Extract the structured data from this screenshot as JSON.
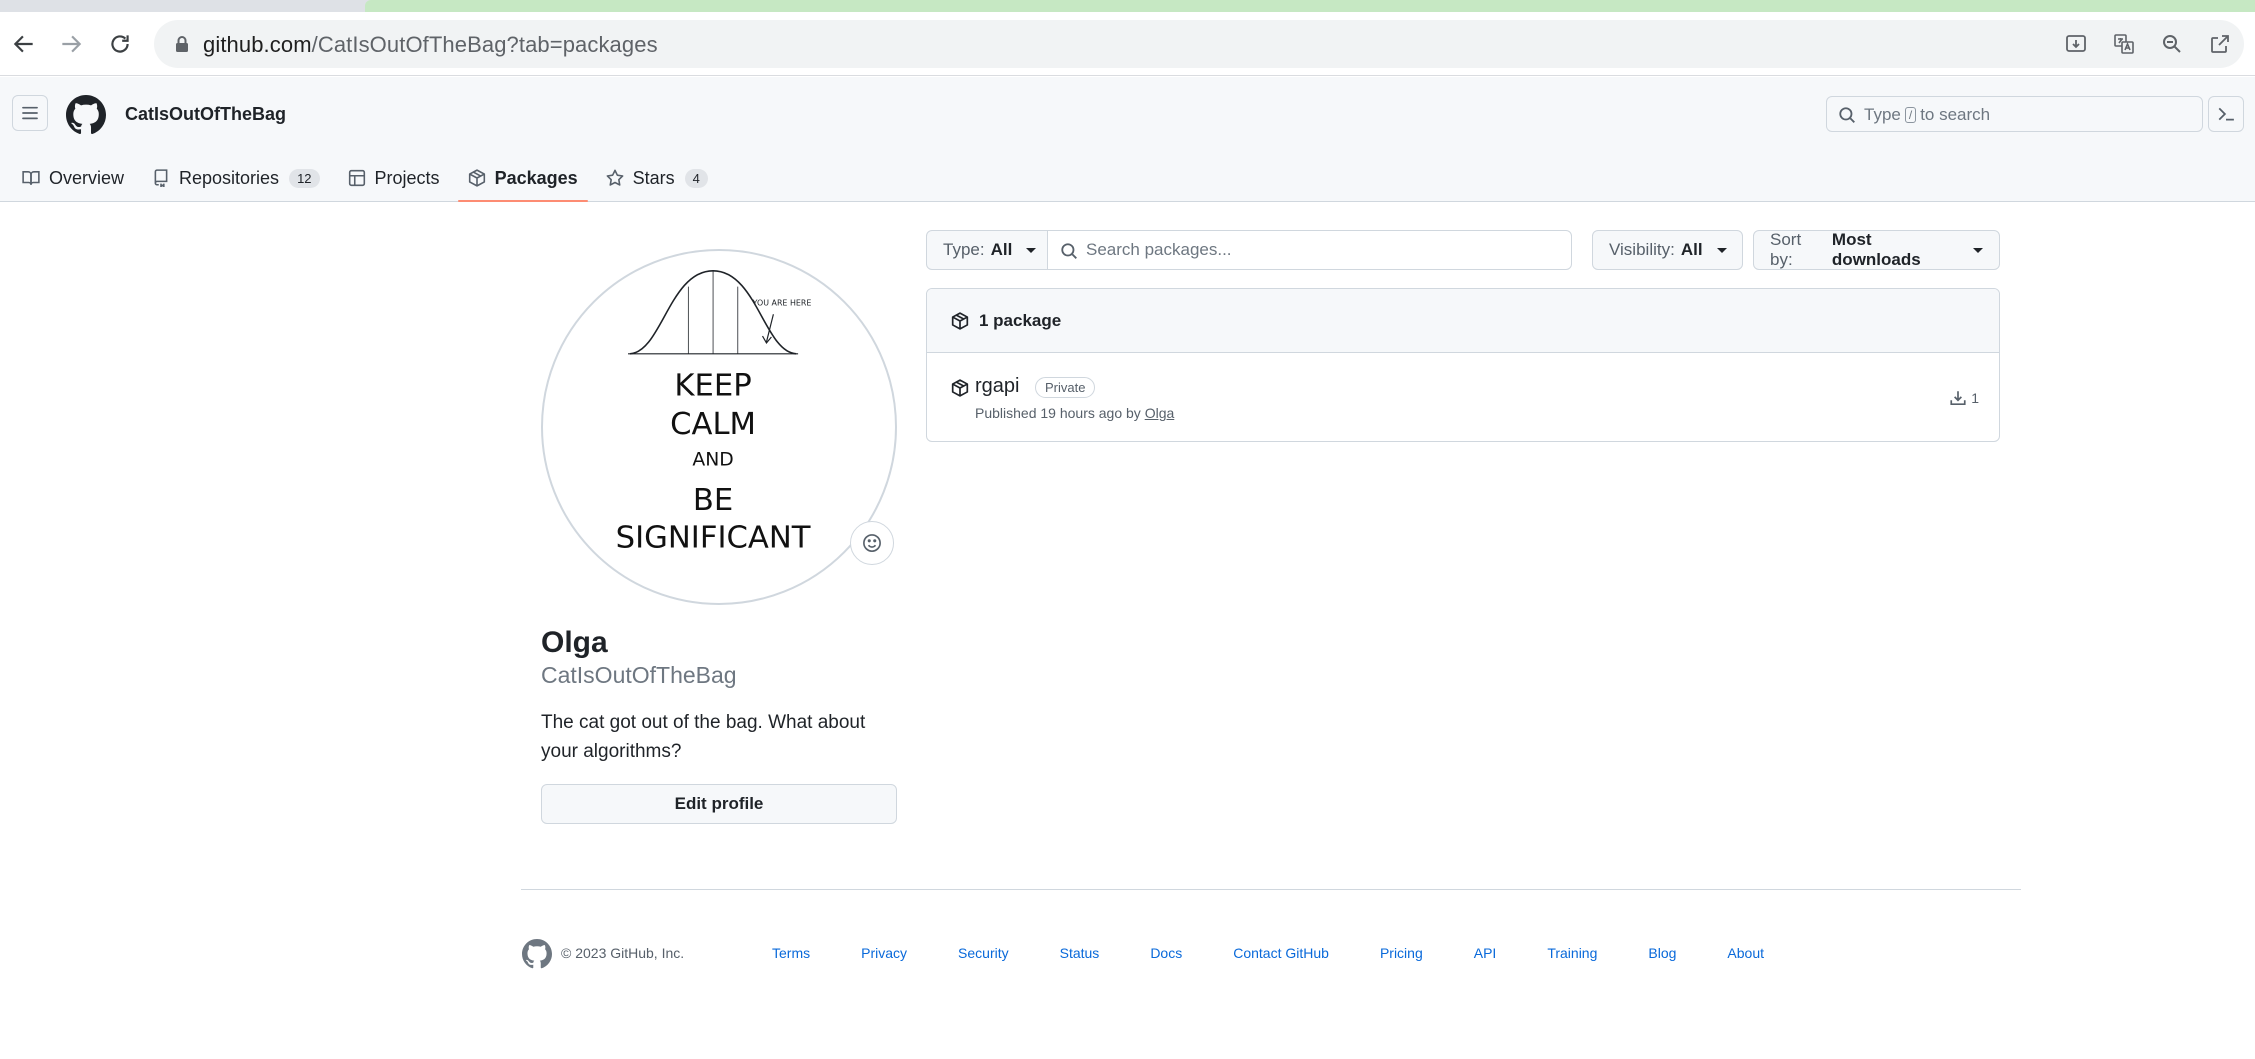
{
  "browser": {
    "url_host": "github.com",
    "url_path": "/CatIsOutOfTheBag?tab=packages"
  },
  "header": {
    "username": "CatIsOutOfTheBag",
    "search_prefix": "Type",
    "search_key": "/",
    "search_suffix": "to search"
  },
  "tabs": [
    {
      "label": "Overview",
      "icon": "book-icon"
    },
    {
      "label": "Repositories",
      "icon": "repo-icon",
      "count": "12"
    },
    {
      "label": "Projects",
      "icon": "table-icon"
    },
    {
      "label": "Packages",
      "icon": "package-icon",
      "active": true
    },
    {
      "label": "Stars",
      "icon": "star-icon",
      "count": "4"
    }
  ],
  "profile": {
    "avatar_text": [
      "YOU ARE HERE",
      "KEEP",
      "CALM",
      "AND",
      "BE",
      "SIGNIFICANT"
    ],
    "name": "Olga",
    "login": "CatIsOutOfTheBag",
    "bio": "The cat got out of the bag. What about your algorithms?",
    "edit_label": "Edit profile"
  },
  "filters": {
    "type_key": "Type:",
    "type_value": "All",
    "search_placeholder": "Search packages...",
    "visibility_key": "Visibility:",
    "visibility_value": "All",
    "sort_key": "Sort by:",
    "sort_value": "Most downloads"
  },
  "packages": {
    "count_label": "1 package",
    "items": [
      {
        "name": "rgapi",
        "badge": "Private",
        "published": "Published 19 hours ago by",
        "owner": "Olga",
        "downloads": "1"
      }
    ]
  },
  "footer": {
    "copyright": "© 2023 GitHub, Inc.",
    "links": [
      "Terms",
      "Privacy",
      "Security",
      "Status",
      "Docs",
      "Contact GitHub",
      "Pricing",
      "API",
      "Training",
      "Blog",
      "About"
    ]
  },
  "colors": {
    "accent_underline": "#fd8c73",
    "link": "#0969da",
    "border": "#d0d7de"
  }
}
